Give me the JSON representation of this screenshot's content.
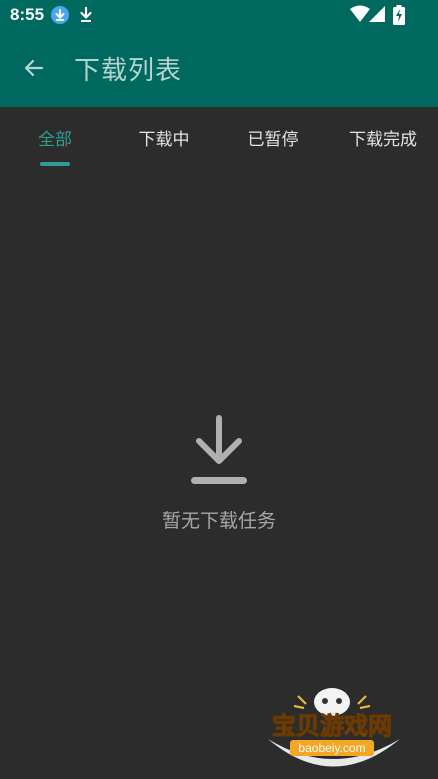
{
  "status_bar": {
    "time": "8:55",
    "icons": [
      "download-badge-icon",
      "download-icon",
      "wifi-icon",
      "signal-icon",
      "battery-charging-icon"
    ]
  },
  "app_bar": {
    "title": "下载列表",
    "back_icon": "arrow-left-icon",
    "background_color": "#00695f"
  },
  "tabs": [
    {
      "label": "全部",
      "active": true
    },
    {
      "label": "下载中",
      "active": false
    },
    {
      "label": "已暂停",
      "active": false
    },
    {
      "label": "下载完成",
      "active": false
    }
  ],
  "accent_color": "#2f9e92",
  "empty_state": {
    "icon": "download-icon",
    "message": "暂无下载任务"
  },
  "watermark": {
    "title": "宝贝游戏网",
    "url": "baobeiy.com"
  }
}
